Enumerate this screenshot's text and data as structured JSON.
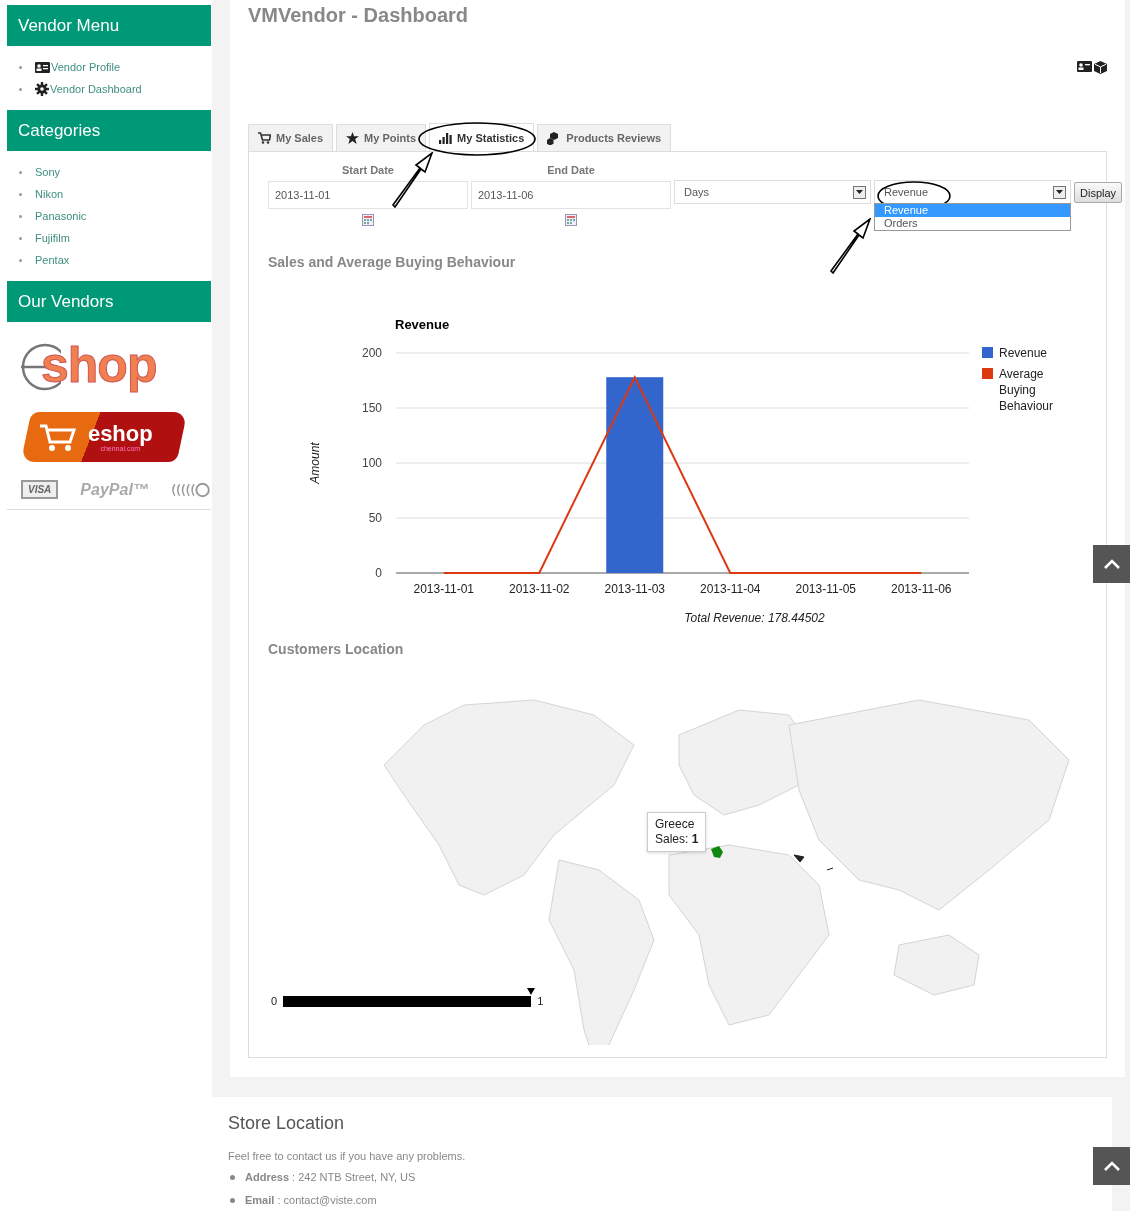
{
  "sidebar": {
    "blocks": [
      {
        "title": "Vendor Menu",
        "kind": "links",
        "items": [
          {
            "label": "Vendor Profile"
          },
          {
            "label": "Vendor Dashboard"
          }
        ]
      },
      {
        "title": "Categories",
        "kind": "links",
        "items": [
          {
            "label": "Sony"
          },
          {
            "label": "Nikon"
          },
          {
            "label": "Panasonic"
          },
          {
            "label": "Fujifilm"
          },
          {
            "label": "Pentax"
          }
        ]
      },
      {
        "title": "Our Vendors",
        "kind": "logos",
        "logos": [
          {
            "kind": "eshop",
            "text": "shop"
          },
          {
            "kind": "chennai",
            "text": "eshop",
            "subtext": "chennai.com"
          }
        ],
        "payments": [
          {
            "kind": "visa",
            "text": "VISA"
          },
          {
            "kind": "paypal",
            "text": "PayPal™"
          },
          {
            "kind": "contactless"
          }
        ]
      }
    ]
  },
  "page_title": "VMVendor - Dashboard",
  "tabs": [
    {
      "label": "My Sales",
      "selected": false
    },
    {
      "label": "My Points",
      "selected": false
    },
    {
      "label": "My Statistics",
      "selected": true
    },
    {
      "label": "Products Reviews",
      "selected": false
    }
  ],
  "filters": {
    "start_date": {
      "label": "Start Date",
      "value": "2013-11-01"
    },
    "end_date": {
      "label": "End Date",
      "value": "2013-11-06"
    },
    "period": {
      "value": "Days"
    },
    "metric": {
      "value": "Revenue",
      "expanded": true,
      "options": [
        {
          "label": "Revenue",
          "selected": true
        },
        {
          "label": "Orders",
          "selected": false
        }
      ]
    },
    "display_button": "Display"
  },
  "sales_section": {
    "title": "Sales and Average Buying Behaviour",
    "chart_data": {
      "type": "bar",
      "title": "Revenue",
      "ylabel": "Amount",
      "xlabel": "Total Revenue: 178.44502",
      "categories": [
        "2013-11-01",
        "2013-11-02",
        "2013-11-03",
        "2013-11-04",
        "2013-11-05",
        "2013-11-06"
      ],
      "ylim": [
        0,
        200
      ],
      "yticks": [
        0,
        50,
        100,
        150,
        200
      ],
      "grid": true,
      "legend": true,
      "series": [
        {
          "name": "Revenue",
          "type": "bar",
          "color": "#3366cc",
          "values": [
            0,
            0,
            178,
            0,
            0,
            0
          ]
        },
        {
          "name": "Average Buying Behaviour",
          "type": "line",
          "color": "#dc3912",
          "values": [
            0,
            0,
            178,
            0,
            0,
            0
          ]
        }
      ]
    }
  },
  "location_section": {
    "title": "Customers Location",
    "tooltip": {
      "title": "Greece",
      "text": "Sales: **1**"
    },
    "legend": {
      "min": "0",
      "max": "1"
    }
  },
  "footer": {
    "title": "Store Location",
    "text": "Feel free to contact us if you have any problems.",
    "items": [
      "**Address** : 242 NTB Street, NY, US",
      "**Email** : contact@viste.com"
    ]
  }
}
